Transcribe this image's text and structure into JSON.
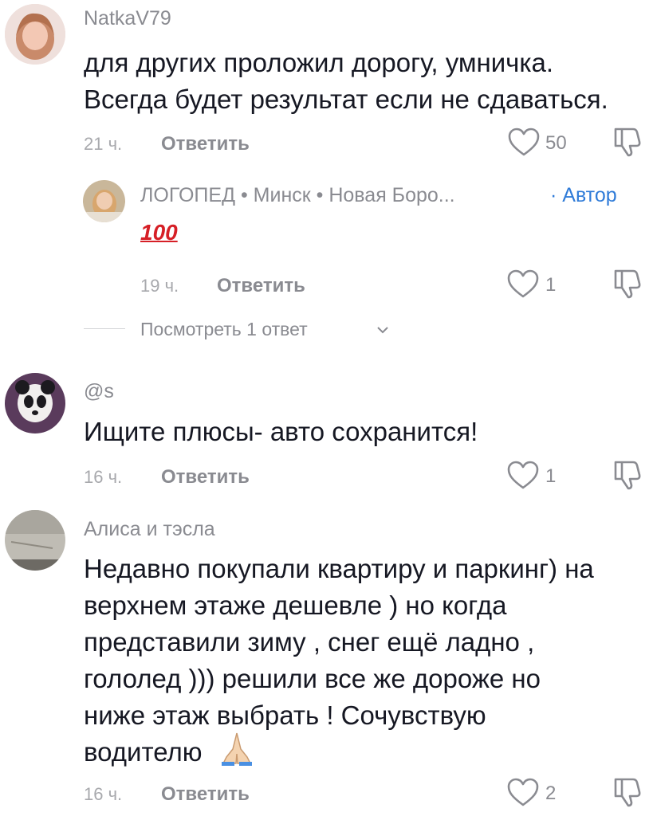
{
  "comments": [
    {
      "username": "NatkaV79",
      "lines": [
        "для других проложил дорогу, умничка.",
        "Всегда будет результат если не сдаваться."
      ],
      "time": "21 ч.",
      "reply_label": "Ответить",
      "likes": "50"
    },
    {
      "username": "@s",
      "lines": [
        "Ищите плюсы- авто сохранится!"
      ],
      "time": "16 ч.",
      "reply_label": "Ответить",
      "likes": "1"
    },
    {
      "username": "Алиса и тэсла",
      "lines": [
        "Недавно покупали квартиру и паркинг) на",
        "верхнем этаже дешевле ) но когда",
        "представили зиму , снег ещё ладно ,",
        "гололед ))) решили все же дороже но",
        "ниже этаж выбрать ! Сочувствую",
        "водителю"
      ],
      "time": "16 ч.",
      "reply_label": "Ответить",
      "likes": "2"
    }
  ],
  "reply": {
    "username": "ЛОГОПЕД • Минск • Новая Боро...",
    "author_badge": "· Автор",
    "emoji_text": "100",
    "time": "19 ч.",
    "reply_label": "Ответить",
    "likes": "1"
  },
  "view_more": "Посмотреть 1 ответ",
  "icons": {
    "like": "heart-outline-icon",
    "dislike": "thumbs-down-icon",
    "chevron": "chevron-down-icon",
    "pray": "folded-hands-emoji"
  }
}
